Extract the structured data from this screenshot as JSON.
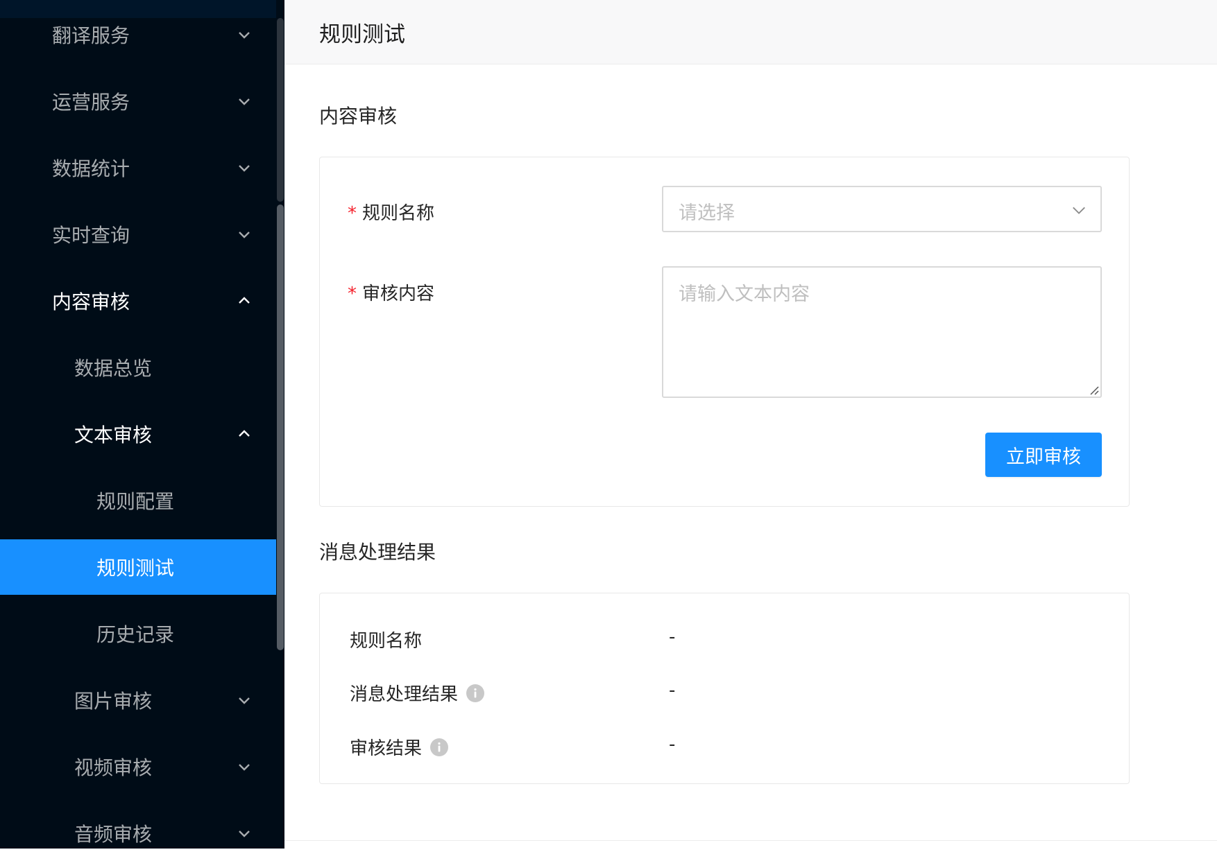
{
  "sidebar": {
    "items": [
      {
        "label": "翻译服务",
        "level": 1,
        "state": "collapsed",
        "chevron": "chevron-down-icon"
      },
      {
        "label": "运营服务",
        "level": 1,
        "state": "collapsed",
        "chevron": "chevron-down-icon"
      },
      {
        "label": "数据统计",
        "level": 1,
        "state": "collapsed",
        "chevron": "chevron-down-icon"
      },
      {
        "label": "实时查询",
        "level": 1,
        "state": "collapsed",
        "chevron": "chevron-down-icon"
      },
      {
        "label": "内容审核",
        "level": 1,
        "state": "open",
        "chevron": "chevron-up-icon"
      },
      {
        "label": "数据总览",
        "level": 2,
        "state": "leaf"
      },
      {
        "label": "文本审核",
        "level": 2,
        "state": "open",
        "chevron": "chevron-up-icon"
      },
      {
        "label": "规则配置",
        "level": 3,
        "state": "leaf"
      },
      {
        "label": "规则测试",
        "level": 3,
        "state": "active"
      },
      {
        "label": "历史记录",
        "level": 3,
        "state": "leaf"
      },
      {
        "label": "图片审核",
        "level": 2,
        "state": "collapsed",
        "chevron": "chevron-down-icon"
      },
      {
        "label": "视频审核",
        "level": 2,
        "state": "collapsed",
        "chevron": "chevron-down-icon"
      },
      {
        "label": "音频审核",
        "level": 2,
        "state": "collapsed",
        "chevron": "chevron-down-icon"
      }
    ]
  },
  "header": {
    "title": "规则测试"
  },
  "audit_section": {
    "title": "内容审核",
    "rule_name_label": "规则名称",
    "rule_name_placeholder": "请选择",
    "content_label": "审核内容",
    "content_placeholder": "请输入文本内容",
    "required_mark": "*",
    "submit_label": "立即审核"
  },
  "result_section": {
    "title": "消息处理结果",
    "rows": [
      {
        "label": "规则名称",
        "value": "-",
        "has_info": false
      },
      {
        "label": "消息处理结果",
        "value": "-",
        "has_info": true
      },
      {
        "label": "审核结果",
        "value": "-",
        "has_info": true
      }
    ]
  },
  "colors": {
    "sidebar_bg": "#000c17",
    "accent": "#1890ff",
    "required": "#f5222d",
    "placeholder": "#bfbfbf"
  }
}
